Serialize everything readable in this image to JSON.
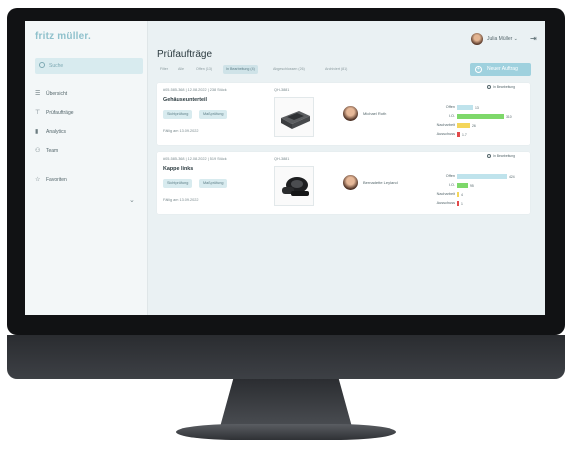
{
  "app": {
    "logo": "fritz müller."
  },
  "sidebar": {
    "search_label": "Suche",
    "items": [
      {
        "label": "Übersicht",
        "icon": "list-icon"
      },
      {
        "label": "Prüfaufträge",
        "icon": "caliper-icon"
      },
      {
        "label": "Analytics",
        "icon": "bar-chart-icon"
      },
      {
        "label": "Team",
        "icon": "team-icon"
      }
    ],
    "favorites_label": "Favoriten",
    "favorites_chevron": "⌄"
  },
  "topbar": {
    "user_name": "Julia Müller ⌄",
    "logout_glyph": "⇥"
  },
  "main": {
    "title": "Prüfaufträge",
    "filters": [
      "Filter",
      "Alle",
      "Offen (13)",
      "In Bearbeitung (4)",
      "Abgeschlossen (26)",
      "Archiviert (81)"
    ],
    "active_filter_index": 3,
    "new_order_label": "Neuer Auftrag",
    "new_order_plus": "+",
    "colors": {
      "accent": "#9fd1de",
      "offen": "#bfe3ec",
      "io": "#7ed86a",
      "nacharbeit": "#f4d65a",
      "ausschuss": "#e24a4a"
    }
  },
  "orders": [
    {
      "meta": "#05-585-368 | 12.08.2022 | 238 Stück",
      "title": "Gehäuseunterteil",
      "tags": [
        "Sichtprüfung",
        "Maßprüfung"
      ],
      "due": "Fällig am 13.09.2022",
      "qh": "QH-3881",
      "person": "Michael Roth",
      "status": "In Bearbeitung",
      "stats": [
        {
          "label": "Offen",
          "value": "13",
          "fraction": 0.3
        },
        {
          "label": "I.O.",
          "value": "310",
          "fraction": 0.88
        },
        {
          "label": "Nacharbeit",
          "value": "26",
          "fraction": 0.24
        },
        {
          "label": "Ausschuss",
          "value": "1.7",
          "fraction": 0.05
        }
      ]
    },
    {
      "meta": "#05-585-368 | 12.08.2022 | 519 Stück",
      "title": "Kappe links",
      "tags": [
        "Sichtprüfung",
        "Maßprüfung"
      ],
      "due": "Fällig am 13.09.2022",
      "qh": "QH-3881",
      "person": "Bernadette Leyland",
      "status": "In Bearbeitung",
      "stats": [
        {
          "label": "Offen",
          "value": "424",
          "fraction": 0.95
        },
        {
          "label": "I.O.",
          "value": "95",
          "fraction": 0.2
        },
        {
          "label": "Nacharbeit",
          "value": "4",
          "fraction": 0.0
        },
        {
          "label": "Ausschuss",
          "value": "1",
          "fraction": 0.03
        }
      ]
    }
  ]
}
